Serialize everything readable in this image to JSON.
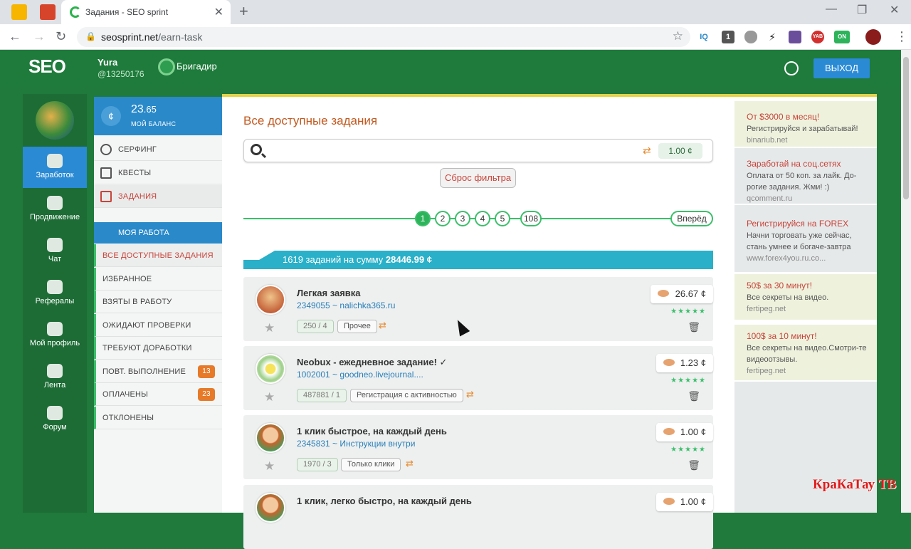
{
  "browser": {
    "tab_title": "Задания - SEO sprint",
    "url_host": "seosprint.net",
    "url_path": "/earn-task",
    "ext_iq": "IQ",
    "ext_badge": "1",
    "ext_yab": "YAB",
    "ext_on": "ON"
  },
  "header": {
    "logo": "SEO",
    "user_name": "Yura",
    "user_id": "@13250176",
    "rank": "Бригадир",
    "logout": "ВЫХОД"
  },
  "left_nav": [
    {
      "label": "Заработок"
    },
    {
      "label": "Продвижение"
    },
    {
      "label": "Чат"
    },
    {
      "label": "Рефералы"
    },
    {
      "label": "Мой профиль"
    },
    {
      "label": "Лента"
    },
    {
      "label": "Форум"
    }
  ],
  "balance": {
    "amount_int": "23",
    "amount_frac": ".65",
    "label": "МОЙ БАЛАНС",
    "coin": "¢"
  },
  "menu": {
    "items": [
      "СЕРФИНГ",
      "КВЕСТЫ",
      "ЗАДАНИЯ"
    ],
    "my_work": "МОЯ РАБОТА",
    "sub": [
      {
        "label": "ВСЕ ДОСТУПНЫЕ ЗАДАНИЯ",
        "count": ""
      },
      {
        "label": "ИЗБРАННОЕ",
        "count": ""
      },
      {
        "label": "ВЗЯТЫ В РАБОТУ",
        "count": ""
      },
      {
        "label": "ОЖИДАЮТ ПРОВЕРКИ",
        "count": ""
      },
      {
        "label": "ТРЕБУЮТ ДОРАБОТКИ",
        "count": ""
      },
      {
        "label": "ПОВТ. ВЫПОЛНЕНИЕ",
        "count": "13"
      },
      {
        "label": "ОПЛАЧЕНЫ",
        "count": "23"
      },
      {
        "label": "ОТКЛОНЕНЫ",
        "count": ""
      }
    ]
  },
  "main": {
    "title": "Все доступные задания",
    "min_price": "1.00 ¢",
    "reset": "Сброс фильтра",
    "pages": [
      "1",
      "2",
      "3",
      "4",
      "5",
      "108"
    ],
    "next": "Вперёд",
    "summary_pre": "1619 заданий на сумму ",
    "summary_sum": "28446.99 ¢"
  },
  "tasks": [
    {
      "title": "Легкая заявка",
      "id_site": "2349055 ~ nalichka365.ru",
      "stat": "250 / 4",
      "category": "Прочее",
      "price": "26.67 ¢",
      "stars": "★★★★★"
    },
    {
      "title": "Neobux - ежедневное задание! ✓",
      "id_site": "1002001 ~ goodneo.livejournal....",
      "stat": "487881 / 1",
      "category": "Регистрация с активностью",
      "price": "1.23 ¢",
      "stars": "★★★★★"
    },
    {
      "title": "1 клик быстрое, на каждый день",
      "id_site": "2345831 ~ Инструкции внутри",
      "stat": "1970 / 3",
      "category": "Только клики",
      "price": "1.00 ¢",
      "stars": "★★★★★"
    },
    {
      "title": "1 клик, легко быстро, на каждый день",
      "id_site": "",
      "stat": "",
      "category": "",
      "price": "1.00 ¢",
      "stars": ""
    }
  ],
  "ads": [
    {
      "head": "От $3000 в месяц!",
      "body": "Регистрируйся и зарабатывай!",
      "url": "binariub.net"
    },
    {
      "head": "Заработай на соц.сетях",
      "body": "Оплата от 50 коп. за лайк. До-рогие задания. Жми! :)",
      "url": "qcomment.ru"
    },
    {
      "head": "Регистрируйся на FOREX",
      "body": "Начни торговать уже сейчас, стань умнее и богаче-завтра",
      "url": "www.forex4you.ru.co..."
    },
    {
      "head": "50$ за 30 минут!",
      "body": "Все секреты на видео.",
      "url": "fertipeg.net"
    },
    {
      "head": "100$ за 10 минут!",
      "body": "Все секреты на видео.Смотри-те видеоотзывы.",
      "url": "fertipeg.net"
    }
  ],
  "watermark": "КраКаТау ТВ"
}
